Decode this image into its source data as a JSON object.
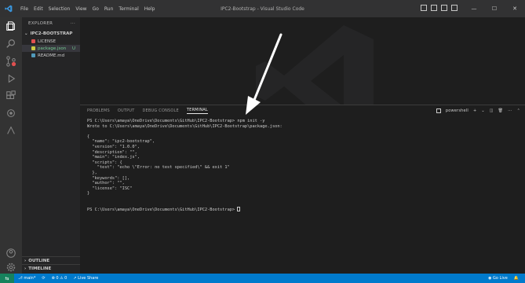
{
  "window": {
    "title": "IPC2-Bootstrap - Visual Studio Code",
    "menu": [
      "File",
      "Edit",
      "Selection",
      "View",
      "Go",
      "Run",
      "Terminal",
      "Help"
    ]
  },
  "sidebar": {
    "header": "EXPLORER",
    "header_more": "···",
    "folder": "IPC2-BOOTSTRAP",
    "files": [
      {
        "name": "LICENSE",
        "icon": "license-icon",
        "color": "#e05050"
      },
      {
        "name": "package.json",
        "icon": "json-icon",
        "color": "#cbcb41",
        "status": "U"
      },
      {
        "name": "README.md",
        "icon": "info-icon",
        "color": "#519aba"
      }
    ],
    "outline": "OUTLINE",
    "timeline": "TIMELINE"
  },
  "panel": {
    "tabs": [
      "PROBLEMS",
      "OUTPUT",
      "DEBUG CONSOLE",
      "TERMINAL"
    ],
    "active_tab": "TERMINAL",
    "shell": "powershell",
    "terminal_lines": [
      "PS C:\\Users\\amaya\\OneDrive\\Documents\\GitHub\\IPC2-Bootstrap> npm init -y",
      "Wrote to C:\\Users\\amaya\\OneDrive\\Documents\\GitHub\\IPC2-Bootstrap\\package.json:",
      "",
      "{",
      "  \"name\": \"ipc2-bootstrap\",",
      "  \"version\": \"1.0.0\",",
      "  \"description\": \"\",",
      "  \"main\": \"index.js\",",
      "  \"scripts\": {",
      "    \"test\": \"echo \\\"Error: no test specified\\\" && exit 1\"",
      "  },",
      "  \"keywords\": [],",
      "  \"author\": \"\",",
      "  \"license\": \"ISC\"",
      "}",
      "",
      ""
    ],
    "prompt": "PS C:\\Users\\amaya\\OneDrive\\Documents\\GitHub\\IPC2-Bootstrap> "
  },
  "statusbar": {
    "branch": "main*",
    "sync": "⟳",
    "errors": "⊗ 0 ⚠ 0",
    "live_share": "Live Share",
    "go_live": "Go Live",
    "colors": {
      "bar": "#007acc",
      "remote": "#16825d"
    }
  }
}
